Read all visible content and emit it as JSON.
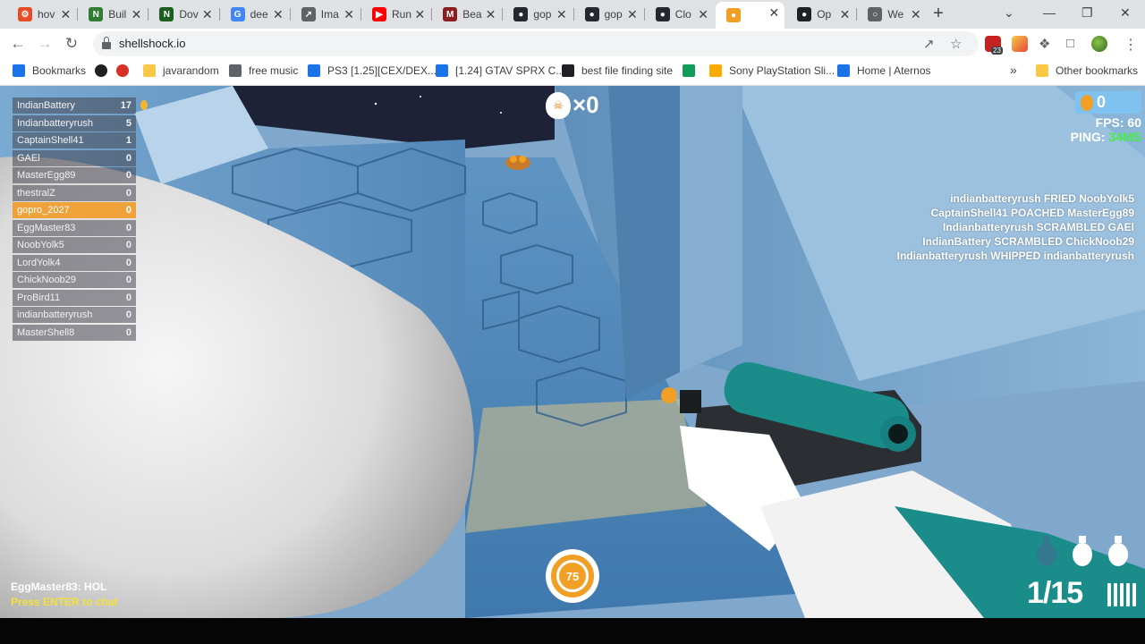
{
  "browser": {
    "tabs": [
      {
        "title": "hov",
        "color": "#e44d26",
        "glyph": "⚙"
      },
      {
        "title": "Buil",
        "color": "#2e7d32",
        "glyph": "N"
      },
      {
        "title": "Dov",
        "color": "#1b5e20",
        "glyph": "N"
      },
      {
        "title": "dee",
        "color": "#4285f4",
        "glyph": "G"
      },
      {
        "title": "Ima",
        "color": "#5f6368",
        "glyph": "↗"
      },
      {
        "title": "Run",
        "color": "#ff0000",
        "glyph": "▶"
      },
      {
        "title": "Bea",
        "color": "#8b1e1e",
        "glyph": "M"
      },
      {
        "title": "gop",
        "color": "#24292f",
        "glyph": "●"
      },
      {
        "title": "gop",
        "color": "#24292f",
        "glyph": "●"
      },
      {
        "title": "Clo",
        "color": "#24292f",
        "glyph": "●"
      },
      {
        "title": "",
        "color": "#f2a025",
        "glyph": "●"
      },
      {
        "title": "Op",
        "color": "#202124",
        "glyph": "●"
      },
      {
        "title": "We",
        "color": "#5f6368",
        "glyph": "○"
      }
    ],
    "active_tab_index": 10,
    "new_tab": "+",
    "window_controls": {
      "minimize": "—",
      "maximize": "❐",
      "close": "✕"
    },
    "tab_search": "⌄",
    "nav": {
      "back": "←",
      "forward": "→",
      "reload": "↻"
    },
    "url": "shellshock.io",
    "extension_badge": "23",
    "menu": "⋮",
    "bookmarks": [
      {
        "label": "Bookmarks",
        "color": "#1a73e8",
        "icon": "star-icon"
      },
      {
        "label": "",
        "color": "#202124",
        "icon": "chrome-icon"
      },
      {
        "label": "",
        "color": "#d93025",
        "icon": "heart-icon"
      },
      {
        "label": "javarandom",
        "color": "#f9c847",
        "icon": "folder-icon"
      },
      {
        "label": "free music",
        "color": "#5f6368",
        "icon": "alien-icon"
      },
      {
        "label": "PS3 [1.25][CEX/DEX...",
        "color": "#1a73e8",
        "icon": "site-icon"
      },
      {
        "label": "[1.24] GTAV SPRX C...",
        "color": "#1a73e8",
        "icon": "site-icon"
      },
      {
        "label": "best file finding site",
        "color": "#202124",
        "icon": "briefcase-icon"
      },
      {
        "label": "",
        "color": "#0f9d58",
        "icon": "site-icon"
      },
      {
        "label": "Sony PlayStation Sli...",
        "color": "#f9ab00",
        "icon": "bag-icon"
      },
      {
        "label": "Home | Aternos",
        "color": "#1a73e8",
        "icon": "grid-icon"
      }
    ],
    "bookmarks_more": "»",
    "other_bookmarks": "Other bookmarks"
  },
  "game": {
    "leaderboard": [
      {
        "name": "IndianBattery",
        "score": "17"
      },
      {
        "name": "Indianbatteryrush",
        "score": "5"
      },
      {
        "name": "CaptainShell41",
        "score": "1"
      },
      {
        "name": "GAEl",
        "score": "0"
      },
      {
        "name": "MasterEgg89",
        "score": "0"
      },
      {
        "name": "thestralZ",
        "score": "0"
      },
      {
        "name": "gopro_2027",
        "score": "0",
        "me": true
      },
      {
        "name": "EggMaster83",
        "score": "0"
      },
      {
        "name": "NoobYolk5",
        "score": "0"
      },
      {
        "name": "LordYolk4",
        "score": "0"
      },
      {
        "name": "ChickNoob29",
        "score": "0"
      },
      {
        "name": "ProBird11",
        "score": "0"
      },
      {
        "name": "indianbatteryrush",
        "score": "0"
      },
      {
        "name": "MasterShell8",
        "score": "0"
      }
    ],
    "kill_count": "×0",
    "coins": "0",
    "fps_label": "FPS:",
    "fps_value": "60",
    "ping_label": "PING:",
    "ping_value": "34MS",
    "kill_feed": [
      "indianbatteryrush FRIED NoobYolk5",
      "CaptainShell41 POACHED MasterEgg89",
      "Indianbatteryrush SCRAMBLED GAEl",
      "IndianBattery SCRAMBLED ChickNoob29",
      "Indianbatteryrush WHIPPED indianbatteryrush"
    ],
    "chat_message": "EggMaster83: HOL",
    "chat_hint": "Press ENTER to chat",
    "health": "75",
    "ammo": "1/15",
    "grenades": 3,
    "colors": {
      "accent": "#f2a025",
      "ping_good": "#44ee44",
      "chat_hint": "#f6e03a",
      "weapon_teal": "#1a8d8a"
    }
  }
}
